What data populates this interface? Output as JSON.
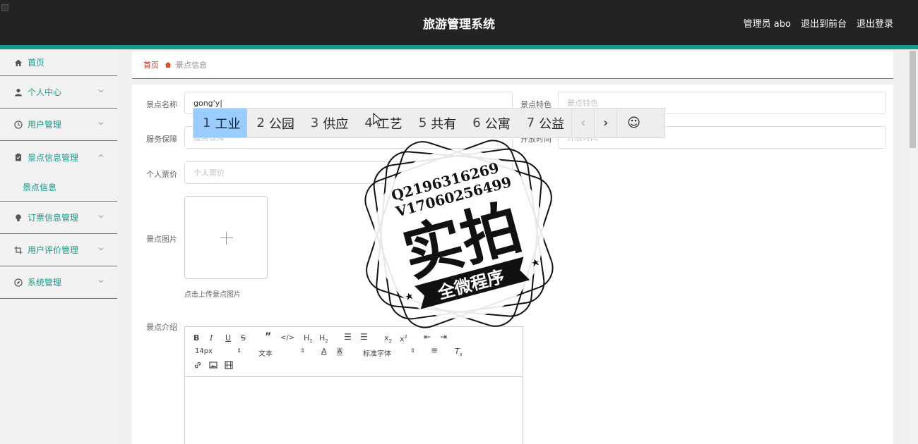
{
  "header": {
    "title": "旅游管理系统",
    "admin_label": "管理员 abo",
    "to_front": "退出到前台",
    "logout": "退出登录"
  },
  "sidebar": {
    "items": [
      {
        "label": "首页",
        "icon": "home-icon"
      },
      {
        "label": "个人中心",
        "icon": "user-icon"
      },
      {
        "label": "用户管理",
        "icon": "clock-icon"
      },
      {
        "label": "景点信息管理",
        "icon": "clipboard-icon",
        "expanded": true
      },
      {
        "label": "订票信息管理",
        "icon": "bulb-icon"
      },
      {
        "label": "用户评价管理",
        "icon": "crop-icon"
      },
      {
        "label": "系统管理",
        "icon": "compass-icon"
      }
    ],
    "subitem": "景点信息"
  },
  "breadcrumb": {
    "home": "首页",
    "current": "景点信息"
  },
  "form": {
    "name_label": "景点名称",
    "name_value": "gong'y|",
    "feature_label": "景点特色",
    "feature_placeholder": "景点特色",
    "service_label": "服务保障",
    "service_placeholder": "服务保障",
    "opentime_label": "开放时间",
    "opentime_placeholder": "开放时间",
    "price_label": "个人票价",
    "price_placeholder": "个人票价",
    "image_label": "景点图片",
    "upload_hint": "点击上传景点图片",
    "intro_label": "景点介绍"
  },
  "editor": {
    "font_size": "14px",
    "paragraph": "文本",
    "font_family": "标准字体"
  },
  "ime": {
    "candidates": [
      {
        "num": "1",
        "text": "工业"
      },
      {
        "num": "2",
        "text": "公园"
      },
      {
        "num": "3",
        "text": "供应"
      },
      {
        "num": "4",
        "text": "工艺"
      },
      {
        "num": "5",
        "text": "共有"
      },
      {
        "num": "6",
        "text": "公寓"
      },
      {
        "num": "7",
        "text": "公益"
      }
    ],
    "prev": "‹",
    "next": "›",
    "emoji": "☺"
  },
  "watermark": {
    "qq": "Q2196316269",
    "vx": "V17060256499",
    "big": "实拍",
    "banner": "全微程序"
  },
  "colors": {
    "teal": "#169a8a",
    "header": "#232323",
    "ime_selected": "#99ccff",
    "breadcrumb_home": "#c0392b"
  }
}
